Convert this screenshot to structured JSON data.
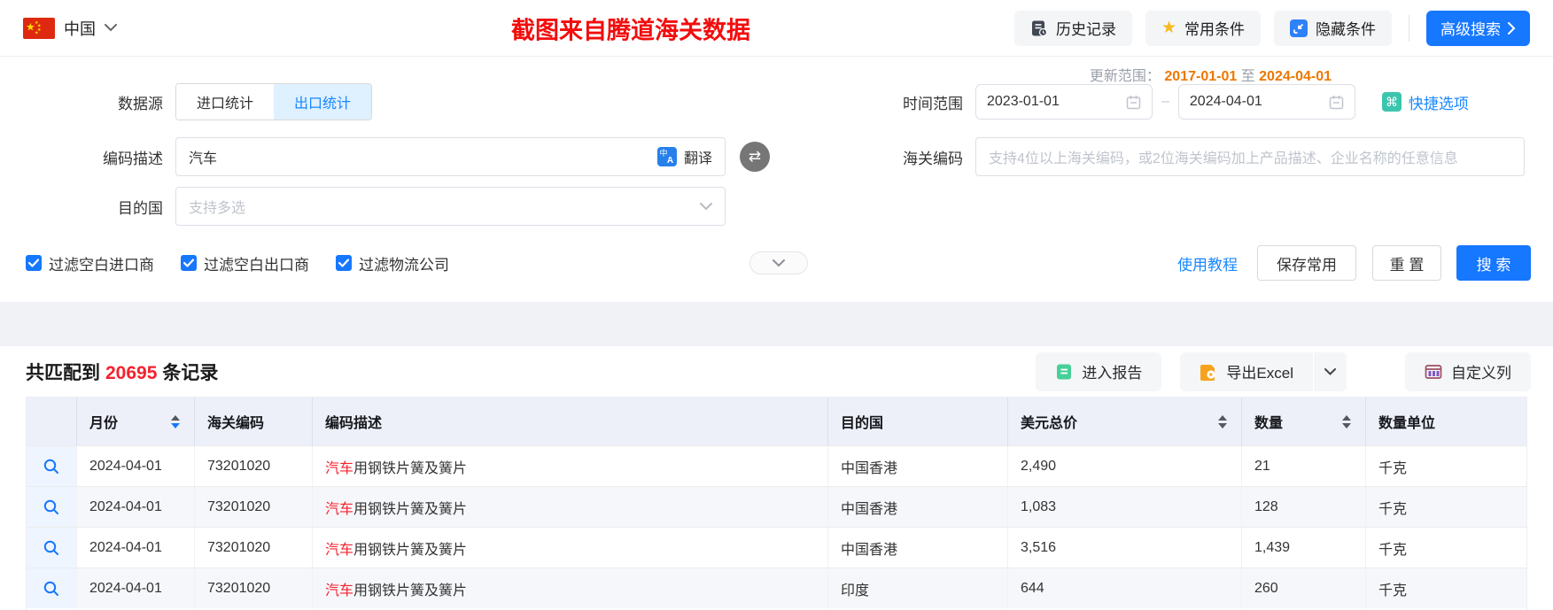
{
  "topbar": {
    "region": {
      "label": "中国"
    },
    "watermark": "截图来自腾道海关数据",
    "history_label": "历史记录",
    "favorites_label": "常用条件",
    "hide_label": "隐藏条件",
    "advanced_label": "高级搜索"
  },
  "form": {
    "update_range": {
      "label": "更新范围：",
      "from": "2017-01-01",
      "to_word": "至",
      "to": "2024-04-01"
    },
    "data_source": {
      "label": "数据源",
      "tab_import": "进口统计",
      "tab_export": "出口统计"
    },
    "time_range": {
      "label": "时间范围",
      "start": "2023-01-01",
      "separator": "–",
      "end": "2024-04-01",
      "quick_label": "快捷选项"
    },
    "description": {
      "label": "编码描述",
      "value": "汽车",
      "translate_label": "翻译"
    },
    "hs_code": {
      "label": "海关编码",
      "placeholder": "支持4位以上海关编码，或2位海关编码加上产品描述、企业名称的任意信息"
    },
    "destination": {
      "label": "目的国",
      "placeholder": "支持多选"
    },
    "checkboxes": [
      {
        "label": "过滤空白进口商",
        "checked": true
      },
      {
        "label": "过滤空白出口商",
        "checked": true
      },
      {
        "label": "过滤物流公司",
        "checked": true
      }
    ],
    "actions": {
      "tutorial": "使用教程",
      "save": "保存常用",
      "reset": "重 置",
      "search": "搜 索"
    }
  },
  "results": {
    "count_prefix": "共匹配到",
    "count": "20695",
    "count_suffix": "条记录",
    "report_label": "进入报告",
    "export_label": "导出Excel",
    "columns_label": "自定义列"
  },
  "table": {
    "headers": {
      "month": "月份",
      "hs_code": "海关编码",
      "description": "编码描述",
      "destination": "目的国",
      "usd_total": "美元总价",
      "quantity": "数量",
      "unit": "数量单位"
    },
    "sort_state": {
      "month": "desc",
      "usd_total": "none",
      "quantity": "none"
    },
    "rows": [
      {
        "month": "2024-04-01",
        "hs_code": "73201020",
        "desc_highlight": "汽车",
        "desc_rest": "用钢铁片簧及簧片",
        "destination": "中国香港",
        "usd_total": "2,490",
        "quantity": "21",
        "unit": "千克"
      },
      {
        "month": "2024-04-01",
        "hs_code": "73201020",
        "desc_highlight": "汽车",
        "desc_rest": "用钢铁片簧及簧片",
        "destination": "中国香港",
        "usd_total": "1,083",
        "quantity": "128",
        "unit": "千克"
      },
      {
        "month": "2024-04-01",
        "hs_code": "73201020",
        "desc_highlight": "汽车",
        "desc_rest": "用钢铁片簧及簧片",
        "destination": "中国香港",
        "usd_total": "3,516",
        "quantity": "1,439",
        "unit": "千克"
      },
      {
        "month": "2024-04-01",
        "hs_code": "73201020",
        "desc_highlight": "汽车",
        "desc_rest": "用钢铁片簧及簧片",
        "destination": "印度",
        "usd_total": "644",
        "quantity": "260",
        "unit": "千克"
      }
    ]
  },
  "colors": {
    "accent": "#1677ff",
    "highlight_red": "#f5222d",
    "date_orange": "#ee7700",
    "table_header_bg": "#edf0f8",
    "band_bg": "#f0f2f6"
  }
}
